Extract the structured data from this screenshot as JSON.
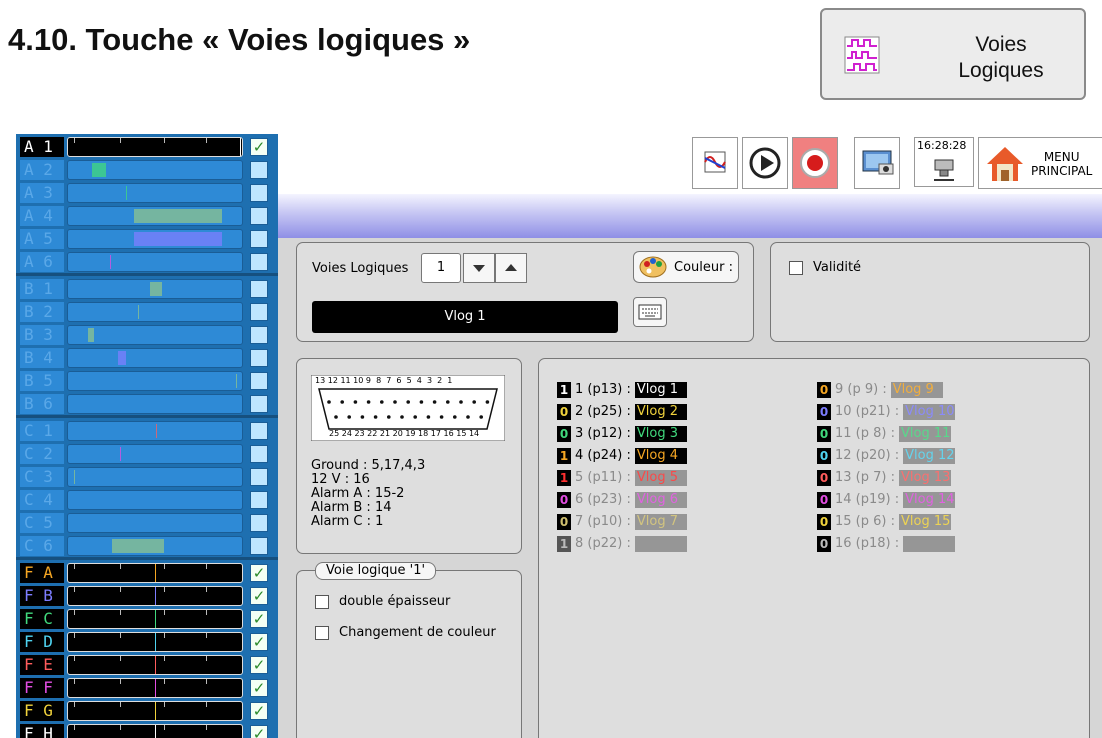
{
  "doc_title": "4.10. Touche « Voies logiques »",
  "voies_button": {
    "line1": "Voies",
    "line2": "Logiques"
  },
  "toolbar": {
    "clock": "16:28:28",
    "menu_line1": "MENU",
    "menu_line2": "PRINCIPAL"
  },
  "channels": [
    {
      "label": "A 1",
      "active": true,
      "checked": true
    },
    {
      "label": "A 2",
      "active": false,
      "checked": false
    },
    {
      "label": "A 3",
      "active": false,
      "checked": false
    },
    {
      "label": "A 4",
      "active": false,
      "checked": false
    },
    {
      "label": "A 5",
      "active": false,
      "checked": false
    },
    {
      "label": "A 6",
      "active": false,
      "checked": false
    },
    {
      "label": "B 1",
      "active": false,
      "checked": false
    },
    {
      "label": "B 2",
      "active": false,
      "checked": false
    },
    {
      "label": "B 3",
      "active": false,
      "checked": false
    },
    {
      "label": "B 4",
      "active": false,
      "checked": false
    },
    {
      "label": "B 5",
      "active": false,
      "checked": false
    },
    {
      "label": "B 6",
      "active": false,
      "checked": false
    },
    {
      "label": "C 1",
      "active": false,
      "checked": false
    },
    {
      "label": "C 2",
      "active": false,
      "checked": false
    },
    {
      "label": "C 3",
      "active": false,
      "checked": false
    },
    {
      "label": "C 4",
      "active": false,
      "checked": false
    },
    {
      "label": "C 5",
      "active": false,
      "checked": false
    },
    {
      "label": "C 6",
      "active": false,
      "checked": false
    },
    {
      "label": "F A",
      "active": true,
      "checked": true,
      "color": "#f5a623"
    },
    {
      "label": "F B",
      "active": true,
      "checked": true,
      "color": "#7d7dff"
    },
    {
      "label": "F C",
      "active": true,
      "checked": true,
      "color": "#41d97d"
    },
    {
      "label": "F D",
      "active": true,
      "checked": true,
      "color": "#4fd3f0"
    },
    {
      "label": "F E",
      "active": true,
      "checked": true,
      "color": "#ff5d5d"
    },
    {
      "label": "F F",
      "active": true,
      "checked": true,
      "color": "#e24de2"
    },
    {
      "label": "F G",
      "active": true,
      "checked": true,
      "color": "#f0d23c"
    },
    {
      "label": "F H",
      "active": true,
      "checked": true,
      "color": "#ffffff"
    }
  ],
  "config": {
    "voies_label": "Voies Logiques",
    "voie_value": "1",
    "couleur_label": "Couleur :",
    "name_value": "Vlog  1",
    "validite_label": "Validité"
  },
  "connector": {
    "top_pins": "13 12 11 10 9  8  7  6  5  4  3  2  1",
    "bottom_pins": "25 24 23 22 21 20 19 18 17 16 15 14",
    "info": [
      "Ground : 5,17,4,3",
      "12 V : 16",
      "Alarm A : 15-2",
      "Alarm B : 14",
      "Alarm C : 1"
    ]
  },
  "options": {
    "legend": "Voie logique '1'",
    "double_label": "double épaisseur",
    "change_label": "Changement de couleur"
  },
  "mapping": [
    {
      "num": "1",
      "pin": "1 (p13) :",
      "name": "Vlog  1",
      "color": "#ffffff",
      "active": true
    },
    {
      "num": "0",
      "pin": "2 (p25) :",
      "name": "Vlog  2",
      "color": "#f0d23c",
      "active": true
    },
    {
      "num": "0",
      "pin": "3 (p12) :",
      "name": "Vlog  3",
      "color": "#41d97d",
      "active": true
    },
    {
      "num": "1",
      "pin": "4 (p24) :",
      "name": "Vlog  4",
      "color": "#f5a623",
      "active": true
    },
    {
      "num": "1",
      "pin": "5 (p11) :",
      "name": "Vlog  5",
      "color": "#ff3030",
      "active": false
    },
    {
      "num": "0",
      "pin": "6 (p23) :",
      "name": "Vlog  6",
      "color": "#e24de2",
      "active": false
    },
    {
      "num": "0",
      "pin": "7 (p10) :",
      "name": "Vlog  7",
      "color": "#d0c070",
      "active": false
    },
    {
      "num": "1",
      "pin": "8 (p22) :",
      "name": "",
      "color": "#ffffff",
      "active": false
    },
    {
      "num": "0",
      "pin": "9 (p 9) :",
      "name": "Vlog  9",
      "color": "#f5a623",
      "active": false
    },
    {
      "num": "0",
      "pin": "10 (p21) :",
      "name": "Vlog 10",
      "color": "#7d7dff",
      "active": false
    },
    {
      "num": "0",
      "pin": "11 (p 8) :",
      "name": "Vlog 11",
      "color": "#41d97d",
      "active": false
    },
    {
      "num": "0",
      "pin": "12 (p20) :",
      "name": "Vlog 12",
      "color": "#4fd3f0",
      "active": false
    },
    {
      "num": "0",
      "pin": "13 (p 7) :",
      "name": "Vlog 13",
      "color": "#ff5d5d",
      "active": false
    },
    {
      "num": "0",
      "pin": "14 (p19) :",
      "name": "Vlog 14",
      "color": "#e24de2",
      "active": false
    },
    {
      "num": "0",
      "pin": "15 (p 6) :",
      "name": "Vlog 15",
      "color": "#f0d23c",
      "active": false
    },
    {
      "num": "0",
      "pin": "16 (p18) :",
      "name": "",
      "color": "#ffffff",
      "active": false
    }
  ]
}
